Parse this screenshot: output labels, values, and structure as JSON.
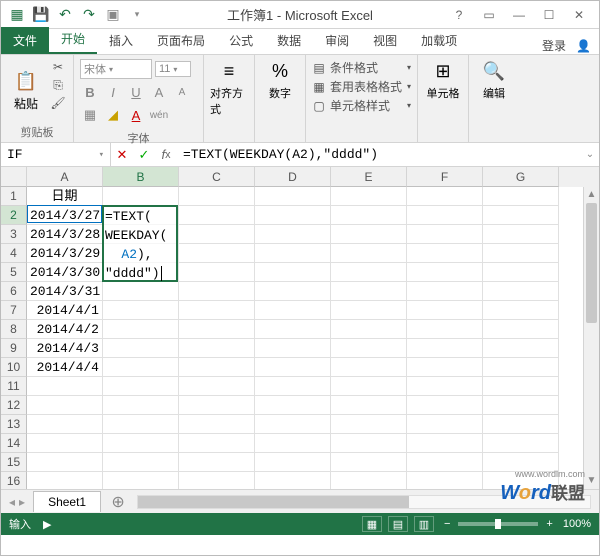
{
  "titlebar": {
    "title": "工作簿1 - Microsoft Excel"
  },
  "tabs": {
    "file": "文件",
    "home": "开始",
    "insert": "插入",
    "layout": "页面布局",
    "formulas": "公式",
    "data": "数据",
    "review": "审阅",
    "view": "视图",
    "addins": "加载项",
    "signin": "登录"
  },
  "ribbon": {
    "clipboard_label": "剪贴板",
    "paste_label": "粘贴",
    "font_label": "字体",
    "font_name": "宋体",
    "font_size": "11",
    "align_label": "对齐方式",
    "number_label": "数字",
    "percent": "%",
    "cond_format": "条件格式",
    "table_format": "套用表格格式",
    "cell_style": "单元格样式",
    "cells_label": "单元格",
    "editing_label": "编辑"
  },
  "formula_bar": {
    "name_box": "IF",
    "formula": "=TEXT(WEEKDAY(A2),\"dddd\")"
  },
  "grid": {
    "columns": [
      "A",
      "B",
      "C",
      "D",
      "E",
      "F",
      "G"
    ],
    "row_count": 17,
    "header_row": {
      "A": "日期"
    },
    "data": [
      {
        "A": "2014/3/27"
      },
      {
        "A": "2014/3/28"
      },
      {
        "A": "2014/3/29"
      },
      {
        "A": "2014/3/30"
      },
      {
        "A": "2014/3/31"
      },
      {
        "A": "2014/4/1"
      },
      {
        "A": "2014/4/2"
      },
      {
        "A": "2014/4/3"
      },
      {
        "A": "2014/4/4"
      }
    ],
    "editing_cell": {
      "line1": "=TEXT(",
      "line2_fn": "WEEKDAY",
      "line2_paren": "(",
      "line3_ref": "A2",
      "line3_rest": "),",
      "line4": "\"dddd\")"
    }
  },
  "sheet_bar": {
    "sheet1": "Sheet1"
  },
  "status_bar": {
    "mode": "输入",
    "zoom": "100%"
  },
  "watermark": {
    "url": "www.wordlm.com",
    "cn": "联盟"
  }
}
